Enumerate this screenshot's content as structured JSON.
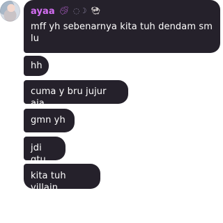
{
  "sender": {
    "name": "ayaa",
    "badges": [
      "ribbon-heart-icon",
      "crescent-moon-icon",
      "ram-icon"
    ],
    "name_color": "#d46ef3"
  },
  "colors": {
    "bubble_bg": "#25212b",
    "text": "#ffffff",
    "page_bg": "#ffffff"
  },
  "messages": [
    "mff yh sebenarnya kita tuh dendam sm lu",
    "hh",
    "cuma y bru jujur aja",
    "gmn yh",
    "jdi gtu",
    "kita tuh villain"
  ]
}
